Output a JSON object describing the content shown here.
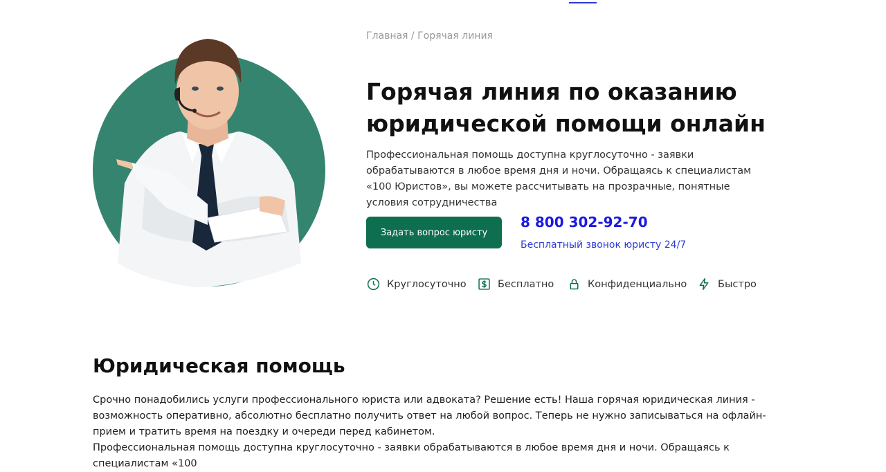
{
  "breadcrumb": {
    "home": "Главная",
    "separator": " / ",
    "current": "Горячая линия"
  },
  "hero": {
    "title_line1": "Горячая линия по оказанию",
    "title_line2": "юридической помощи онлайн",
    "description": "Профессиональная помощь доступна круглосуточно - заявки обрабатываются в любое время дня и ночи. Обращаясь к специалистам «100 Юристов», вы можете рассчитывать на прозрачные, понятные условия сотрудничества",
    "ask_button_label": "Задать вопрос юристу",
    "phone": "8 800 302-92-70",
    "phone_note": "Бесплатный звонок юристу 24/7"
  },
  "features": [
    {
      "icon": "clock-icon",
      "label": "Круглосуточно"
    },
    {
      "icon": "dollar-icon",
      "label": "Бесплатно"
    },
    {
      "icon": "lock-icon",
      "label": "Конфиденциально"
    },
    {
      "icon": "lightning-icon",
      "label": "Быстро"
    }
  ],
  "section": {
    "title": "Юридическая помощь",
    "paragraph1": "Срочно понадобились услуги профессионального юриста или адвоката? Решение есть! Наша горячая юридическая линия - возможность оперативно, абсолютно бесплатно получить ответ на любой вопрос. Теперь не нужно записываться на офлайн-прием и тратить время на поездку и очереди перед кабинетом.",
    "paragraph2": "Профессиональная помощь доступна круглосуточно - заявки обрабатываются в любое время дня и ночи. Обращаясь к специалистам «100"
  },
  "colors": {
    "accent_green": "#0d6e50",
    "circle_green": "#358470",
    "phone_blue": "#1a1ae0",
    "link_blue": "#2e3ad6"
  }
}
